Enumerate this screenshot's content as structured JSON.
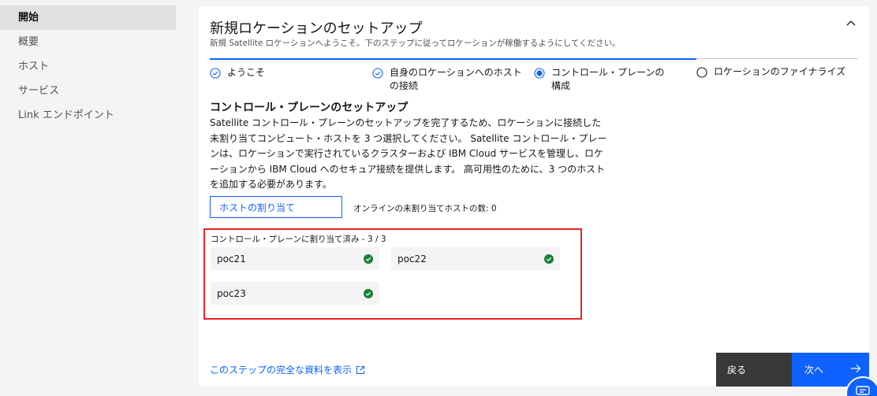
{
  "sidebar": {
    "items": [
      {
        "label": "開始",
        "active": true
      },
      {
        "label": "概要"
      },
      {
        "label": "ホスト"
      },
      {
        "label": "サービス"
      },
      {
        "label": "Link エンドポイント"
      }
    ]
  },
  "card": {
    "title": "新規ロケーションのセットアップ",
    "subtitle": "新規 Satellite ロケーションへようこそ。下のステップに従ってロケーションが稼働するようにしてください。"
  },
  "steps": [
    {
      "label": "ようこそ",
      "status": "complete"
    },
    {
      "label": "自身のロケーションへのホストの接続",
      "status": "complete"
    },
    {
      "label": "コントロール・プレーンの構成",
      "status": "current"
    },
    {
      "label": "ロケーションのファイナライズ",
      "status": "incomplete"
    }
  ],
  "section": {
    "title": "コントロール・プレーンのセットアップ",
    "description": "Satellite コントロール・プレーンのセットアップを完了するため、ロケーションに接続した未割り当てコンピュート・ホストを 3 つ選択してください。 Satellite コントロール・プレーンは、ロケーションで実行されているクラスターおよび IBM Cloud サービスを管理し、ロケーションから IBM Cloud へのセキュア接続を提供します。 高可用性のために、3 つのホストを追加する必要があります。",
    "assign_button": "ホストの割り当て",
    "online_count": "オンラインの未割り当てホストの数: 0",
    "assigned_label": "コントロール・プレーンに割り当て済み - 3 / 3",
    "hosts": [
      {
        "name": "poc21",
        "status": "ok"
      },
      {
        "name": "poc22",
        "status": "ok"
      },
      {
        "name": "poc23",
        "status": "ok"
      }
    ]
  },
  "footer": {
    "docs_link": "このステップの完全な資料を表示",
    "back_label": "戻る",
    "next_label": "次へ"
  },
  "colors": {
    "accent": "#0f62fe",
    "success": "#198038",
    "highlight": "#e82424",
    "dark_button": "#393939"
  }
}
